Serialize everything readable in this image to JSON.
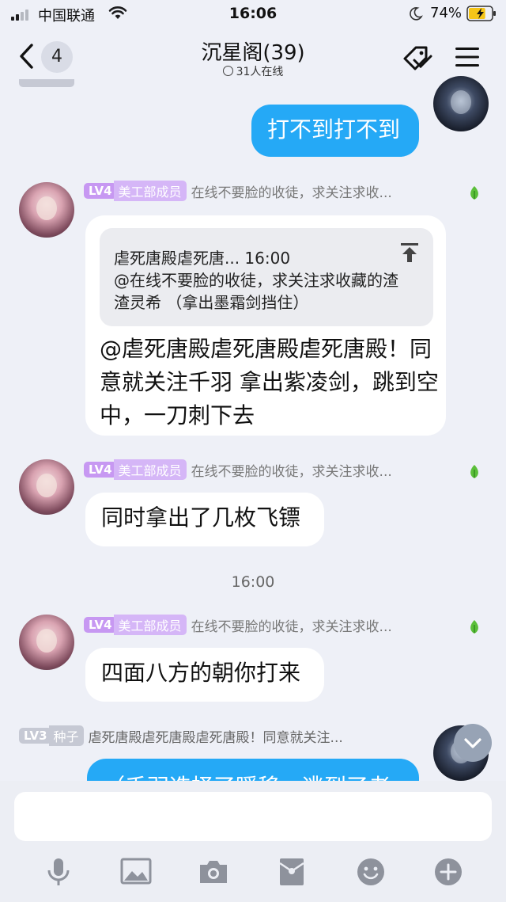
{
  "status_bar": {
    "carrier": "中国联通",
    "time": "16:06",
    "battery_percent": "74%",
    "battery_level": 0.74
  },
  "header": {
    "back_count": "4",
    "title": "沉星阁(39)",
    "online": "31人在线"
  },
  "messages": [
    {
      "id": "m_blue_top",
      "type": "self",
      "text": "打不到打不到"
    },
    {
      "id": "m1",
      "type": "other",
      "level": "LV4",
      "role": "美工部成员",
      "sender": "在线不要脸的收徒，求关注求收...",
      "quote": {
        "header": "虐死唐殿虐死唐... 16:00",
        "body": "@在线不要脸的收徒，求关注求收藏的渣渣灵希 （拿出墨霜剑挡住）"
      },
      "text": "@虐死唐殿虐死唐殿虐死唐殿！同意就关注千羽 拿出紫凌剑，跳到空中，一刀刺下去"
    },
    {
      "id": "m2",
      "type": "other",
      "level": "LV4",
      "role": "美工部成员",
      "sender": "在线不要脸的收徒，求关注求收...",
      "text": "同时拿出了几枚飞镖"
    },
    {
      "id": "ts",
      "type": "timestamp",
      "text": "16:00"
    },
    {
      "id": "m3",
      "type": "other",
      "level": "LV4",
      "role": "美工部成员",
      "sender": "在线不要脸的收徒，求关注求收...",
      "text": "四面八方的朝你打来"
    },
    {
      "id": "m4",
      "type": "self",
      "level": "LV3",
      "role": "种子",
      "sender": "虐死唐殿虐死唐殿虐死唐殿！同意就关注...",
      "text": "（千羽选择了瞬移，逃到了老"
    }
  ],
  "toolbar": {
    "icons": [
      "microphone-icon",
      "image-icon",
      "camera-icon",
      "red-packet-icon",
      "emoji-icon",
      "plus-icon"
    ]
  },
  "colors": {
    "accent_blue": "#25a9f6",
    "level_purple": "#c798f2",
    "background": "#eef0f7"
  }
}
